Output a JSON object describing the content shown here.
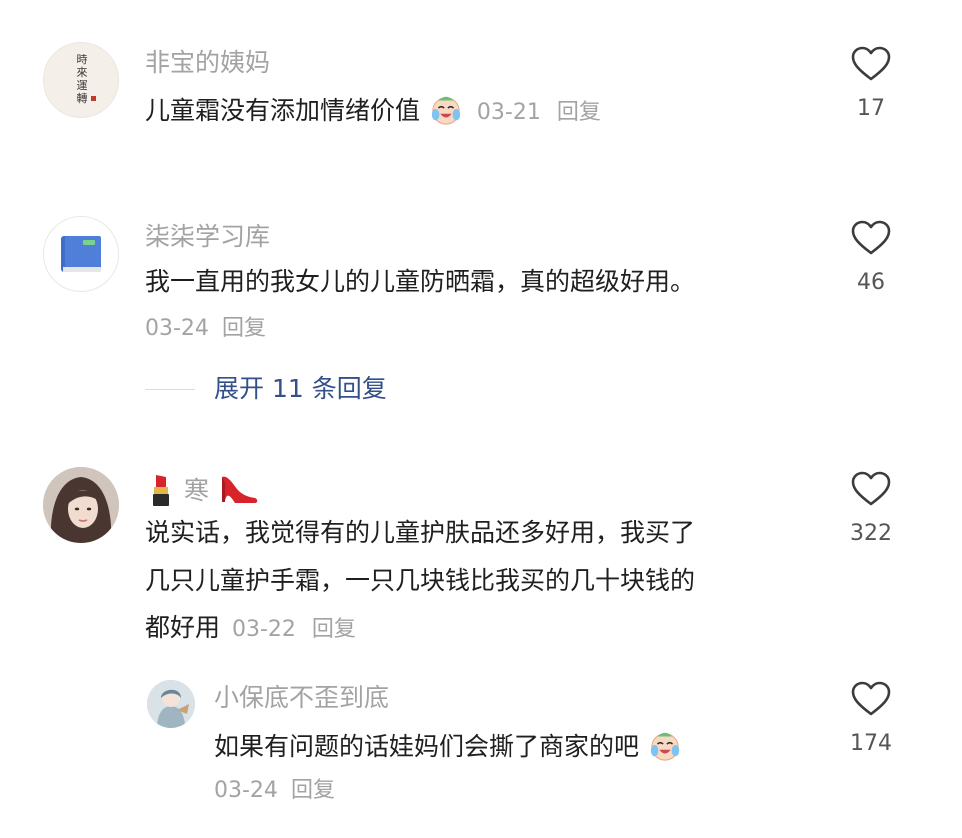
{
  "comments": [
    {
      "username": "非宝的姨妈",
      "avatar_text": [
        "時",
        "來",
        "運",
        "轉"
      ],
      "text": "儿童霜没有添加情绪价值",
      "emoji": "crying-laughing-emoji",
      "date": "03-21",
      "reply_label": "回复",
      "likes": "17"
    },
    {
      "username": "柒柒学习库",
      "text": "我一直用的我女儿的儿童防晒霜，真的超级好用。",
      "date": "03-24",
      "reply_label": "回复",
      "likes": "46",
      "expand_label": "展开 11 条回复"
    },
    {
      "username": "寒",
      "username_prefix_emoji": "lipstick-emoji",
      "username_suffix_emoji": "high-heel-emoji",
      "text_lines": [
        "说实话，我觉得有的儿童护肤品还多好用，我买了",
        "几只儿童护手霜，一只几块钱比我买的几十块钱的",
        "都好用"
      ],
      "date": "03-22",
      "reply_label": "回复",
      "likes": "322"
    },
    {
      "username": "小保底不歪到底",
      "text": "如果有问题的话娃妈们会撕了商家的吧",
      "emoji": "crying-laughing-emoji",
      "date": "03-24",
      "reply_label": "回复",
      "likes": "174"
    }
  ],
  "colors": {
    "username": "#a3a3a3",
    "text": "#1f1f1f",
    "expand_link": "#34508a",
    "like_count": "#555555"
  }
}
